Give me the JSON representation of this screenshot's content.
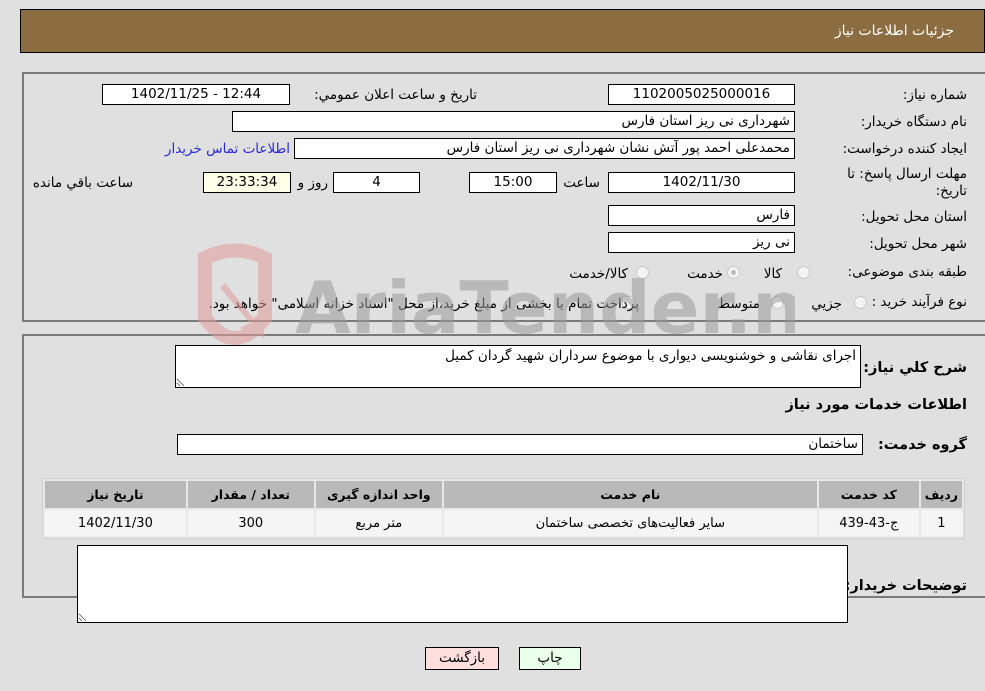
{
  "header": {
    "title": "جزئیات اطلاعات نیاز"
  },
  "form": {
    "need_number": {
      "label": "شماره نیاز:",
      "value": "1102005025000016"
    },
    "announce_datetime": {
      "label": "تاریخ و ساعت اعلان عمومي:",
      "value": "1402/11/25 - 12:44"
    },
    "buyer_org": {
      "label": "نام دستگاه خریدار:",
      "value": "شهرداری نی ریز استان فارس"
    },
    "requester": {
      "label": "ایجاد کننده درخواست:",
      "value": "محمدعلی احمد پور آتش نشان شهرداری نی ریز استان فارس",
      "contact_link": "اطلاعات تماس خریدار"
    },
    "deadline": {
      "label": "مهلت ارسال پاسخ: تا تاریخ:",
      "date": "1402/11/30",
      "time_label": "ساعت",
      "time": "15:00",
      "days": "4",
      "days_label": "روز و",
      "remaining": "23:33:34",
      "remaining_label": "ساعت باقي مانده"
    },
    "delivery_province": {
      "label": "استان محل تحویل:",
      "value": "فارس"
    },
    "delivery_city": {
      "label": "شهر محل تحویل:",
      "value": "نی ریز"
    },
    "category": {
      "label": "طبقه بندی موضوعی:",
      "options": [
        "کالا",
        "خدمت",
        "کالا/خدمت"
      ],
      "selected": "خدمت"
    },
    "purchase_type": {
      "label": "نوع فرآیند خرید :",
      "options": [
        "جزیي",
        "متوسط"
      ],
      "treasury_note": "پرداخت تمام یا بخشی از مبلغ خرید،از محل \"اسناد خزانه اسلامی\" خواهد بود."
    }
  },
  "details": {
    "description_label": "شرح كلي نياز:",
    "description": "اجرای نقاشی و خوشنویسی دیواری با موضوع سرداران شهید گردان کمیل",
    "services_title": "اطلاعات خدمات مورد نیاز",
    "service_group_label": "گروه خدمت:",
    "service_group": "ساختمان",
    "table": {
      "headers": [
        "ردیف",
        "کد خدمت",
        "نام خدمت",
        "واحد اندازه گیری",
        "تعداد / مقدار",
        "تاریخ نیاز"
      ],
      "rows": [
        [
          "1",
          "ج-43-439",
          "سایر فعالیت‌های تخصصی ساختمان",
          "متر مربع",
          "300",
          "1402/11/30"
        ]
      ]
    },
    "buyer_notes_label": "توضیحات خریدار:",
    "buyer_notes": ""
  },
  "buttons": {
    "print": "چاپ",
    "back": "بازگشت"
  },
  "watermark": {
    "text": "AriaTender.neT"
  },
  "colors": {
    "header_bg": "#8c6d42",
    "print_bg": "#eaffea",
    "back_bg": "#ffdede",
    "link": "#2a2ad8"
  }
}
